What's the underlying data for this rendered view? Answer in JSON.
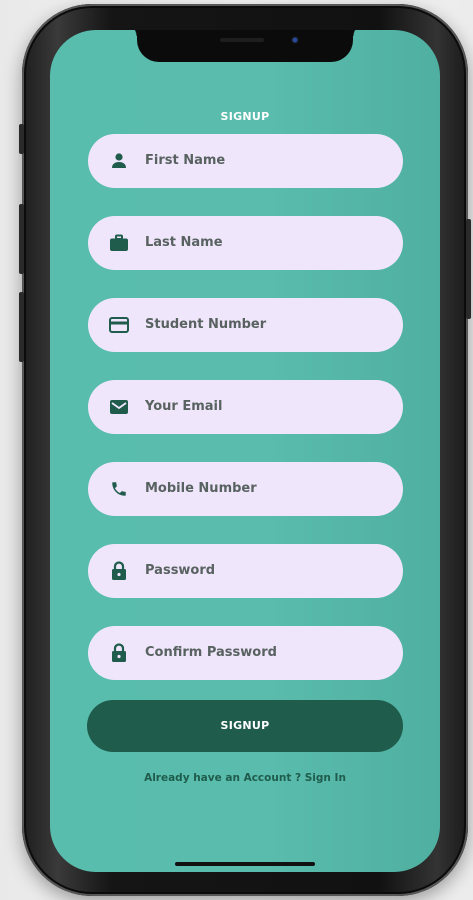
{
  "screen": {
    "title": "SIGNUP",
    "fields": [
      {
        "icon": "person-icon",
        "placeholder": "First Name"
      },
      {
        "icon": "briefcase-icon",
        "placeholder": "Last Name"
      },
      {
        "icon": "card-icon",
        "placeholder": "Student Number"
      },
      {
        "icon": "mail-icon",
        "placeholder": "Your Email"
      },
      {
        "icon": "phone-icon",
        "placeholder": "Mobile Number"
      },
      {
        "icon": "lock-icon",
        "placeholder": "Password"
      },
      {
        "icon": "lock-icon",
        "placeholder": "Confirm Password"
      }
    ],
    "submit_label": "SIGNUP",
    "signin_link": "Already have an Account ? Sign In"
  },
  "colors": {
    "background": "#58bdad",
    "field_fill": "#f0e6fb",
    "icon_color": "#1f5c4c",
    "button_fill": "#1f5c4c",
    "text_white": "#ffffff"
  }
}
